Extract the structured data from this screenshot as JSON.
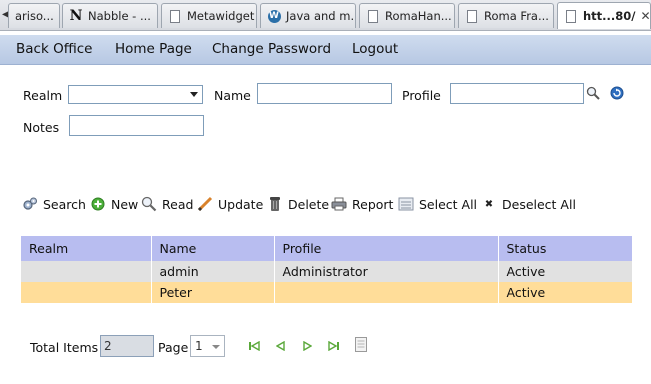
{
  "browser": {
    "tabs": [
      {
        "label": "ariso...",
        "icon": "page-icon"
      },
      {
        "label": "Nabble - ...",
        "icon": "nabble-icon"
      },
      {
        "label": "Metawidget",
        "icon": "page-icon"
      },
      {
        "label": "Java and m...",
        "icon": "wordpress-icon"
      },
      {
        "label": "RomaHan...",
        "icon": "page-icon"
      },
      {
        "label": "Roma Fra...",
        "icon": "page-icon"
      },
      {
        "label": "htt...80/",
        "icon": "page-icon",
        "active": true
      }
    ],
    "nabble_glyph": "N",
    "wordpress_glyph": "W",
    "close_glyph": "✕"
  },
  "menu": {
    "items": [
      "Back Office",
      "Home Page",
      "Change Password",
      "Logout"
    ]
  },
  "form": {
    "realm_label": "Realm",
    "realm_value": "",
    "name_label": "Name",
    "name_value": "",
    "profile_label": "Profile",
    "profile_value": "",
    "notes_label": "Notes",
    "notes_value": ""
  },
  "toolbar": {
    "search": "Search",
    "new": "New",
    "read": "Read",
    "update": "Update",
    "delete": "Delete",
    "report": "Report",
    "select_all": "Select All",
    "deselect_all": "Deselect All",
    "deselect_glyph": "✖"
  },
  "grid": {
    "columns": [
      "Realm",
      "Name",
      "Profile",
      "Status"
    ],
    "rows": [
      [
        "",
        "admin",
        "Administrator",
        "Active"
      ],
      [
        "",
        "Peter",
        "",
        "Active"
      ]
    ],
    "selected_row_color": "#ffdd99",
    "header_color": "#b8bdf0"
  },
  "pager": {
    "total_label": "Total Items",
    "total_value": "2",
    "page_label": "Page",
    "page_value": "1"
  },
  "colors": {
    "menubar": "#c4d3ea",
    "nav_green": "#5aa83a"
  }
}
